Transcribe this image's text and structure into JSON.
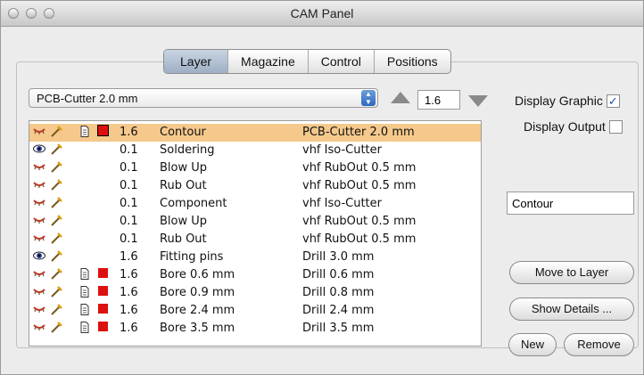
{
  "window": {
    "title": "CAM Panel"
  },
  "tabs": [
    {
      "label": "Layer",
      "active": true
    },
    {
      "label": "Magazine",
      "active": false
    },
    {
      "label": "Control",
      "active": false
    },
    {
      "label": "Positions",
      "active": false
    }
  ],
  "machine_select": {
    "value": "PCB-Cutter 2.0 mm"
  },
  "step": {
    "value": "1.6"
  },
  "display_graphic": {
    "label": "Display Graphic",
    "checked": true
  },
  "display_output": {
    "label": "Display Output",
    "checked": false
  },
  "layers": [
    {
      "depth": "1.6",
      "name": "Contour",
      "tool": "PCB-Cutter 2.0 mm",
      "selected": true,
      "eye": "closed",
      "color": true,
      "doc": true
    },
    {
      "depth": "0.1",
      "name": "Soldering",
      "tool": "vhf Iso-Cutter",
      "selected": false,
      "eye": "open",
      "color": false,
      "doc": false
    },
    {
      "depth": "0.1",
      "name": "Blow Up",
      "tool": "vhf RubOut 0.5 mm",
      "selected": false,
      "eye": "closed",
      "color": false,
      "doc": false
    },
    {
      "depth": "0.1",
      "name": "Rub Out",
      "tool": "vhf RubOut 0.5 mm",
      "selected": false,
      "eye": "closed",
      "color": false,
      "doc": false
    },
    {
      "depth": "0.1",
      "name": "Component",
      "tool": "vhf Iso-Cutter",
      "selected": false,
      "eye": "closed",
      "color": false,
      "doc": false
    },
    {
      "depth": "0.1",
      "name": "Blow Up",
      "tool": "vhf RubOut 0.5 mm",
      "selected": false,
      "eye": "closed",
      "color": false,
      "doc": false
    },
    {
      "depth": "0.1",
      "name": "Rub Out",
      "tool": "vhf RubOut 0.5 mm",
      "selected": false,
      "eye": "closed",
      "color": false,
      "doc": false
    },
    {
      "depth": "1.6",
      "name": "Fitting pins",
      "tool": "Drill 3.0 mm",
      "selected": false,
      "eye": "open",
      "color": false,
      "doc": false
    },
    {
      "depth": "1.6",
      "name": "Bore 0.6 mm",
      "tool": "Drill 0.6 mm",
      "selected": false,
      "eye": "closed",
      "color": true,
      "doc": true
    },
    {
      "depth": "1.6",
      "name": "Bore 0.9 mm",
      "tool": "Drill 0.8 mm",
      "selected": false,
      "eye": "closed",
      "color": true,
      "doc": true
    },
    {
      "depth": "1.6",
      "name": "Bore 2.4 mm",
      "tool": "Drill 2.4 mm",
      "selected": false,
      "eye": "closed",
      "color": true,
      "doc": true
    },
    {
      "depth": "1.6",
      "name": "Bore 3.5 mm",
      "tool": "Drill 3.5 mm",
      "selected": false,
      "eye": "closed",
      "color": true,
      "doc": true
    }
  ],
  "layer_name_field": {
    "value": "Contour"
  },
  "buttons": {
    "move_to_layer": "Move to Layer",
    "show_details": "Show Details ...",
    "new": "New",
    "remove": "Remove"
  },
  "colors": {
    "selection": "#f5c98c",
    "layer_color": "#dd1010",
    "tab_active": "#a9b9cf"
  }
}
